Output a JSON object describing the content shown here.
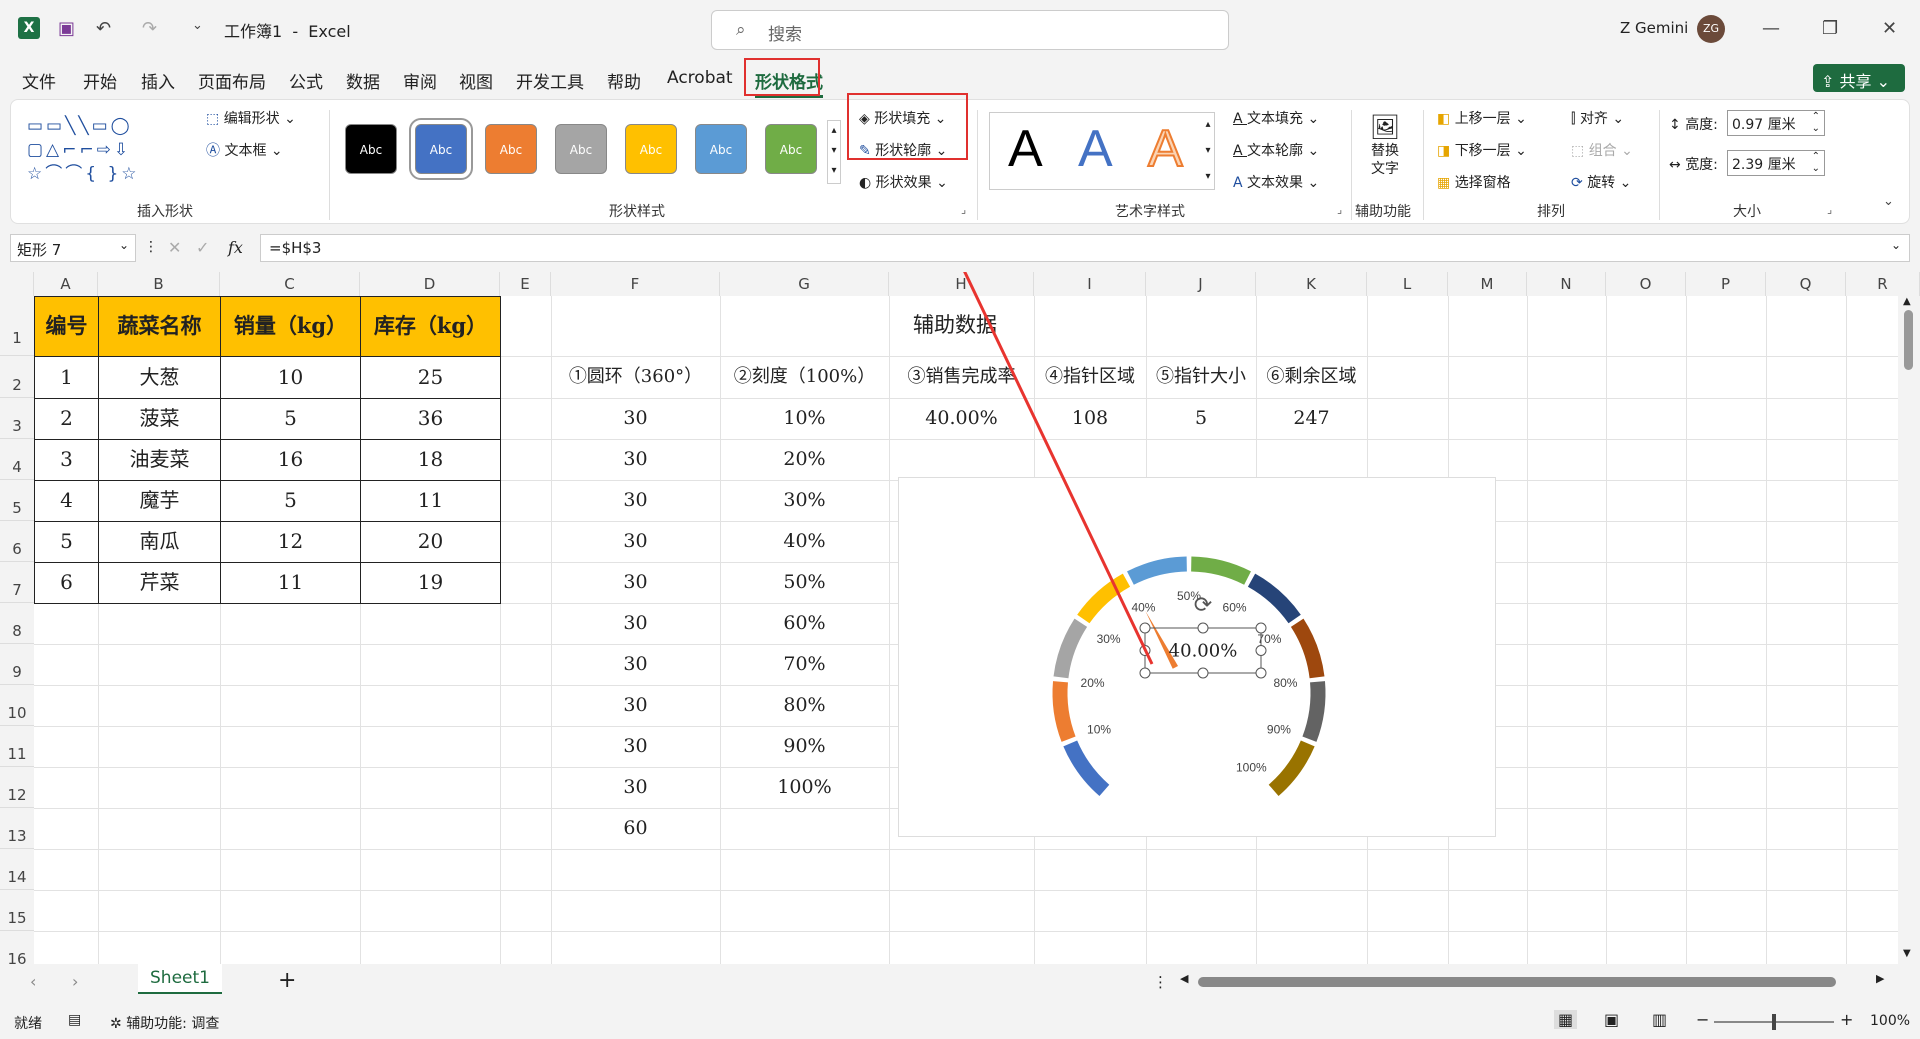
{
  "titlebar": {
    "doc_title": "工作簿1  -  Excel",
    "search_placeholder": "搜索",
    "user_name": "Z Gemini",
    "avatar_initials": "ZG"
  },
  "menu": [
    "文件",
    "开始",
    "插入",
    "页面布局",
    "公式",
    "数据",
    "审阅",
    "视图",
    "开发工具",
    "帮助",
    "Acrobat",
    "形状格式"
  ],
  "share_label": "共享",
  "ribbon": {
    "insert_shapes": {
      "edit_shape": "编辑形状",
      "text_box": "文本框",
      "label": "插入形状"
    },
    "shape_styles": {
      "swatches": [
        {
          "text": "Abc",
          "color": "#000000"
        },
        {
          "text": "Abc",
          "color": "#4472c4"
        },
        {
          "text": "Abc",
          "color": "#ed7d31"
        },
        {
          "text": "Abc",
          "color": "#a5a5a5"
        },
        {
          "text": "Abc",
          "color": "#ffc000"
        },
        {
          "text": "Abc",
          "color": "#5b9bd5"
        },
        {
          "text": "Abc",
          "color": "#70ad47"
        }
      ],
      "fill": "形状填充",
      "outline": "形状轮廓",
      "effects": "形状效果",
      "label": "形状样式"
    },
    "wordart": {
      "letters": [
        "A",
        "A",
        "A"
      ],
      "text_fill": "文本填充",
      "text_outline": "文本轮廓",
      "text_effects": "文本效果",
      "label": "艺术字样式"
    },
    "accessibility": {
      "alt_text_1": "替换",
      "alt_text_2": "文字",
      "label": "辅助功能"
    },
    "arrange": {
      "bring_forward": "上移一层",
      "send_backward": "下移一层",
      "selection_pane": "选择窗格",
      "align": "对齐",
      "group": "组合",
      "rotate": "旋转",
      "label": "排列"
    },
    "size": {
      "height_label": "高度:",
      "height_value": "0.97 厘米",
      "width_label": "宽度:",
      "width_value": "2.39 厘米",
      "label": "大小"
    }
  },
  "formula_bar": {
    "name_box": "矩形 7",
    "fx": "fx",
    "formula": "=$H$3"
  },
  "columns": [
    "A",
    "B",
    "C",
    "D",
    "E",
    "F",
    "G",
    "H",
    "I",
    "J",
    "K",
    "L",
    "M",
    "N",
    "O",
    "P",
    "Q",
    "R"
  ],
  "rows": [
    "1",
    "2",
    "3",
    "4",
    "5",
    "6",
    "7",
    "8",
    "9",
    "10",
    "11",
    "12",
    "13",
    "14",
    "15",
    "16"
  ],
  "table": {
    "headers": [
      "编号",
      "蔬菜名称",
      "销量（kg）",
      "库存（kg）"
    ],
    "rows": [
      [
        "1",
        "大葱",
        "10",
        "25"
      ],
      [
        "2",
        "菠菜",
        "5",
        "36"
      ],
      [
        "3",
        "油麦菜",
        "16",
        "18"
      ],
      [
        "4",
        "魔芋",
        "5",
        "11"
      ],
      [
        "5",
        "南瓜",
        "12",
        "20"
      ],
      [
        "6",
        "芹菜",
        "11",
        "19"
      ]
    ]
  },
  "aux": {
    "title": "辅助数据",
    "headers": [
      "①圆环（360°）",
      "②刻度（100%）",
      "③销售完成率",
      "④指针区域",
      "⑤指针大小",
      "⑥剩余区域"
    ],
    "f_values": [
      "30",
      "30",
      "30",
      "30",
      "30",
      "30",
      "30",
      "30",
      "30",
      "30",
      "60"
    ],
    "g_values": [
      "10%",
      "20%",
      "30%",
      "40%",
      "50%",
      "60%",
      "70%",
      "80%",
      "90%",
      "100%"
    ],
    "h3": "40.00%",
    "i3": "108",
    "j3": "5",
    "k3": "247"
  },
  "gauge": {
    "ticks": [
      "10%",
      "20%",
      "30%",
      "40%",
      "50%",
      "60%",
      "70%",
      "80%",
      "90%",
      "100%"
    ],
    "colors": [
      "#4472c4",
      "#ed7d31",
      "#a5a5a5",
      "#ffc000",
      "#5b9bd5",
      "#70ad47",
      "#264478",
      "#9e480e",
      "#636363",
      "#997300"
    ],
    "textbox_value": "40.00%",
    "pointer_color": "#ed7d31"
  },
  "sheet_tab": "Sheet1",
  "status": {
    "ready": "就绪",
    "accessibility": "辅助功能: 调查",
    "zoom": "100%"
  }
}
